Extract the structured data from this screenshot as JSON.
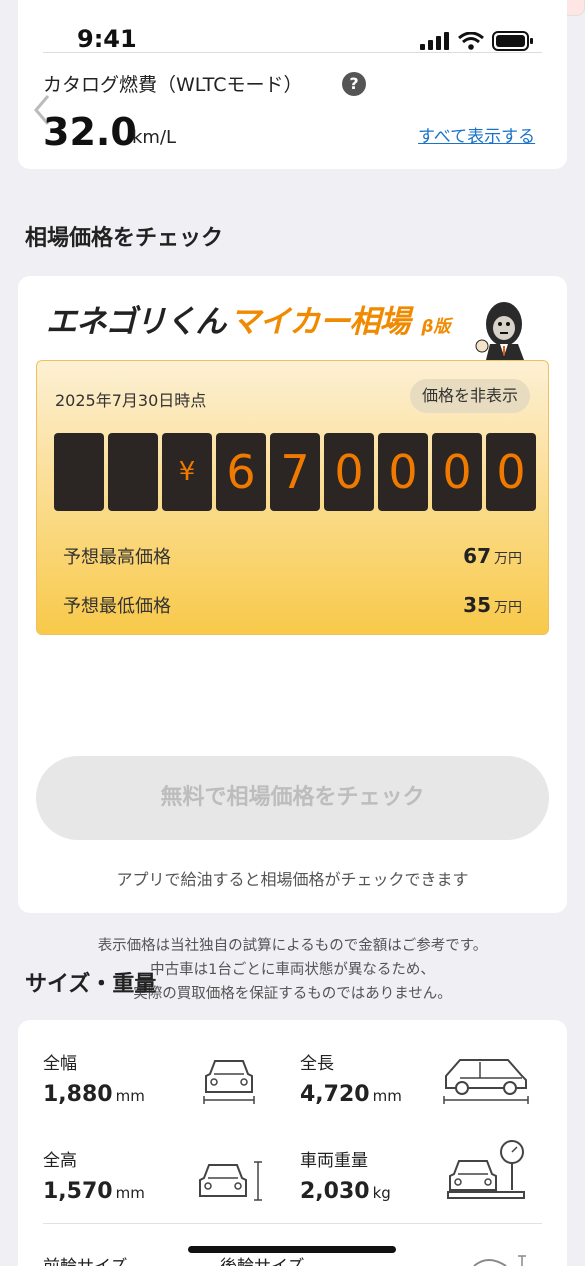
{
  "status": {
    "time": "9:41"
  },
  "fuel": {
    "label": "カタログ燃費（WLTCモード）",
    "value": "32.0",
    "unit": "km/L",
    "show_all": "すべて表示する"
  },
  "market": {
    "section_title": "相場価格をチェック",
    "banner_main": "エネゴリくん",
    "banner_accent": "マイカー相場",
    "banner_beta": "β版",
    "date": "2025年7月30日時点",
    "hide_button": "価格を非表示",
    "digits": [
      "",
      "",
      "¥",
      "6",
      "7",
      "0",
      "0",
      "0",
      "0"
    ],
    "max_label": "予想最高価格",
    "max_value": "67",
    "min_label": "予想最低価格",
    "min_value": "35",
    "unit_man": "万円",
    "disclaimer": [
      "表示価格は当社独自の試算によるもので金額はご参考です。",
      "中古車は1台ごとに車両状態が異なるため、",
      "実際の買取価格を保証するものではありません。"
    ],
    "check_button": "無料で相場価格をチェック",
    "app_note": "アプリで給油すると相場価格がチェックできます"
  },
  "size": {
    "section_title": "サイズ・重量",
    "width_label": "全幅",
    "width_value": "1,880",
    "width_unit": "mm",
    "length_label": "全長",
    "length_value": "4,720",
    "length_unit": "mm",
    "height_label": "全高",
    "height_value": "1,570",
    "height_unit": "mm",
    "weight_label": "車両重量",
    "weight_value": "2,030",
    "weight_unit": "kg",
    "front_tire_label": "前輪サイズ",
    "rear_tire_label": "後輪サイズ"
  },
  "colors": {
    "accent": "#f08a00",
    "link": "#1a73c9",
    "digit_bg": "#2b2624"
  }
}
